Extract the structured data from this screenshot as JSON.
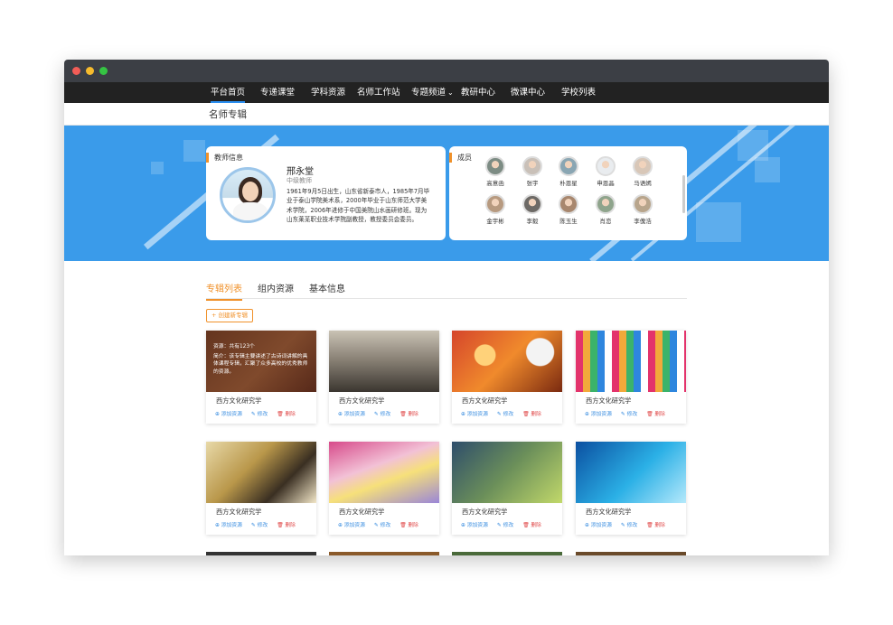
{
  "nav": {
    "items": [
      "平台首页",
      "专递课堂",
      "学科资源",
      "名师工作站",
      "专题频道",
      "教研中心",
      "微课中心",
      "学校列表"
    ],
    "dropdown_marker": "⌄"
  },
  "page_title": "名师专辑",
  "teacher": {
    "section_label": "教师信息",
    "name": "邢永堂",
    "rank": "中级教师",
    "bio": "1961年9月5日出生，山东省新泰市人，1985年7月毕业于泰山学院美术系，2000年毕业于山东师范大学美术学院，2006年进修于中国美院山水画研修班。现为山东莱芜职业技术学院副教授，教授委员会委员。"
  },
  "members": {
    "section_label": "成员",
    "people": [
      {
        "name": "高意函",
        "color": "#7d8c84"
      },
      {
        "name": "张宇",
        "color": "#c9c0b8"
      },
      {
        "name": "朴恩星",
        "color": "#8aa6b3"
      },
      {
        "name": "申恩晶",
        "color": "#e9ecef"
      },
      {
        "name": "马语嫣",
        "color": "#d8c7b8"
      },
      {
        "name": "金宇彬",
        "color": "#b79a80"
      },
      {
        "name": "李毅",
        "color": "#6d6a66"
      },
      {
        "name": "陈玉生",
        "color": "#a8876e"
      },
      {
        "name": "肖恋",
        "color": "#8fa48c"
      },
      {
        "name": "李傀浩",
        "color": "#b8a58c"
      }
    ]
  },
  "tabs": [
    "专辑列表",
    "组内资源",
    "基本信息"
  ],
  "create_button": "+ 创建新专辑",
  "overlay": {
    "count_line": "资源：共有123个",
    "intro_line": "简介：该专辑主要讲述了古诗词讲解的具体课程专辑，汇聚了众多高校的优秀教师的资源。"
  },
  "actions": {
    "add": "⊕ 添加资源",
    "edit": "✎ 修改",
    "delete": "🗑 删除"
  },
  "albums": [
    {
      "title": "西方文化研究学",
      "theme": "brown"
    },
    {
      "title": "西方文化研究学",
      "theme": "war"
    },
    {
      "title": "西方文化研究学",
      "theme": "bulb"
    },
    {
      "title": "西方文化研究学",
      "theme": "pixel"
    },
    {
      "title": "西方文化研究学",
      "theme": "book"
    },
    {
      "title": "西方文化研究学",
      "theme": "ruler"
    },
    {
      "title": "西方文化研究学",
      "theme": "art"
    },
    {
      "title": "西方文化研究学",
      "theme": "tech"
    }
  ]
}
